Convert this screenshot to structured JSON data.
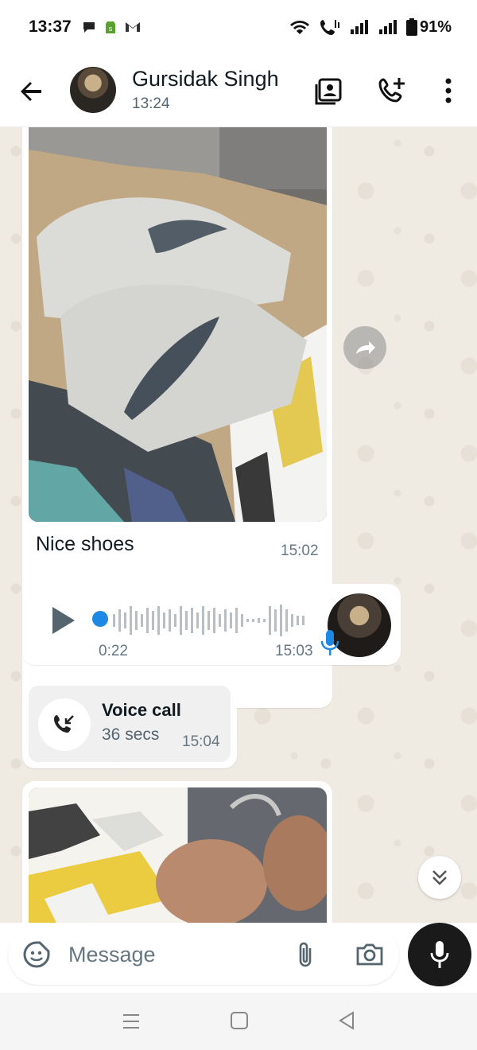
{
  "status_bar": {
    "time": "13:37",
    "battery": "91%",
    "left_icons": [
      "chat-bubble-icon",
      "shopify-icon",
      "gmail-icon"
    ],
    "right_icons": [
      "wifi-icon",
      "wifi-call-icon",
      "signal-icon",
      "signal-icon",
      "battery-icon"
    ]
  },
  "header": {
    "contact_name": "Gursidak Singh",
    "last_seen": "13:24",
    "icons": [
      "back-arrow-icon",
      "contact-card-icon",
      "add-call-icon",
      "more-vertical-icon"
    ]
  },
  "messages": {
    "image_1": {
      "caption": "Nice shoes",
      "time": "15:02"
    },
    "voice": {
      "duration": "0:22",
      "time": "15:03"
    },
    "call": {
      "title": "Voice call",
      "duration": "36 secs",
      "time": "15:04"
    }
  },
  "compose": {
    "placeholder": "Message",
    "icons": [
      "sticker-icon",
      "attach-icon",
      "camera-icon",
      "mic-icon"
    ]
  },
  "colors": {
    "chat_background": "#efeae2",
    "accent_blue": "#1e88e5",
    "mic_button": "#1a1a1a"
  }
}
